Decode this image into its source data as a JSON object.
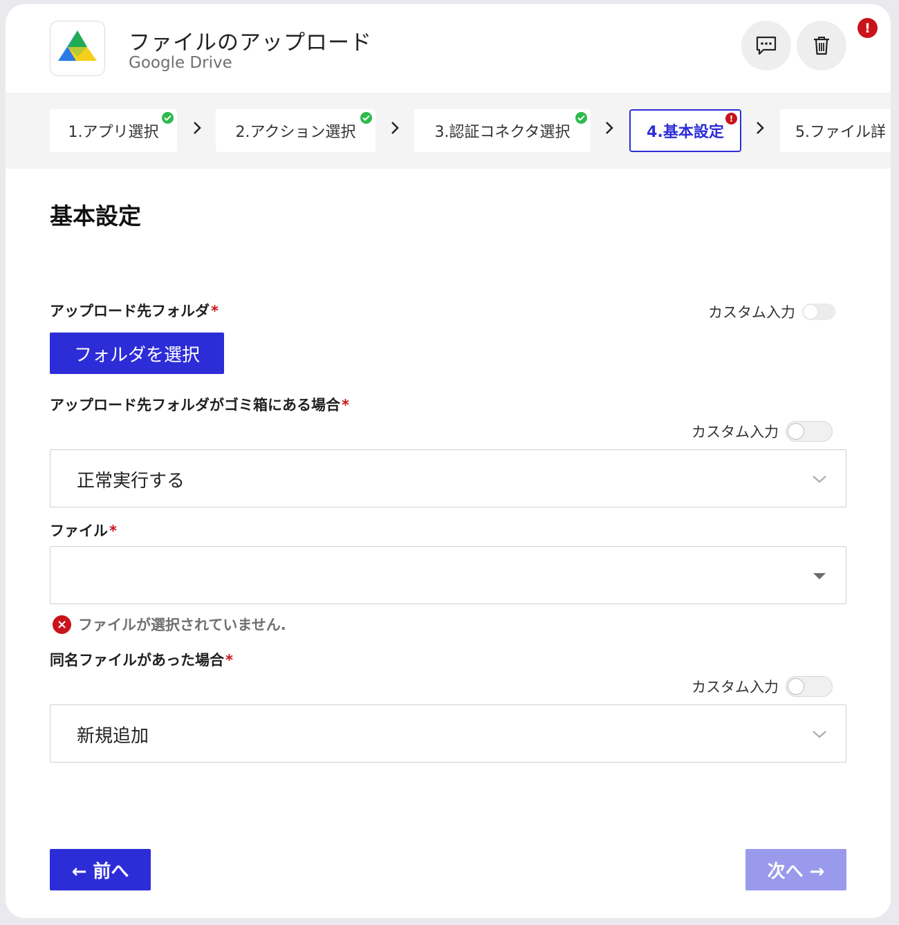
{
  "header": {
    "title": "ファイルのアップロード",
    "subtitle": "Google Drive",
    "alert_symbol": "!",
    "icons": {
      "app": "google-drive-icon",
      "comment": "comment-icon",
      "trash": "trash-icon"
    }
  },
  "steps": [
    {
      "label": "1.アプリ選択",
      "status": "done"
    },
    {
      "label": "2.アクション選択",
      "status": "done"
    },
    {
      "label": "3.認証コネクタ選択",
      "status": "done"
    },
    {
      "label": "4.基本設定",
      "status": "error"
    },
    {
      "label": "5.ファイル詳",
      "status": "pending"
    }
  ],
  "section": {
    "title": "基本設定"
  },
  "fields": {
    "upload_folder": {
      "label": "アップロード先フォルダ",
      "required_mark": "*",
      "custom_label": "カスタム入力",
      "button_label": "フォルダを選択"
    },
    "trash_folder": {
      "label": "アップロード先フォルダがゴミ箱にある場合",
      "required_mark": "*",
      "custom_label": "カスタム入力",
      "value": "正常実行する"
    },
    "file": {
      "label": "ファイル",
      "required_mark": "*",
      "value": "",
      "error_icon": "×",
      "error": "ファイルが選択されていません."
    },
    "same_name": {
      "label": "同名ファイルがあった場合",
      "required_mark": "*",
      "custom_label": "カスタム入力",
      "value": "新規追加"
    }
  },
  "footer": {
    "prev_label": "← 前へ",
    "next_label": "次へ →"
  },
  "colors": {
    "primary": "#2d2dd8",
    "disabled": "#9a9aec",
    "error": "#c8141a",
    "success": "#2dbb4b"
  }
}
